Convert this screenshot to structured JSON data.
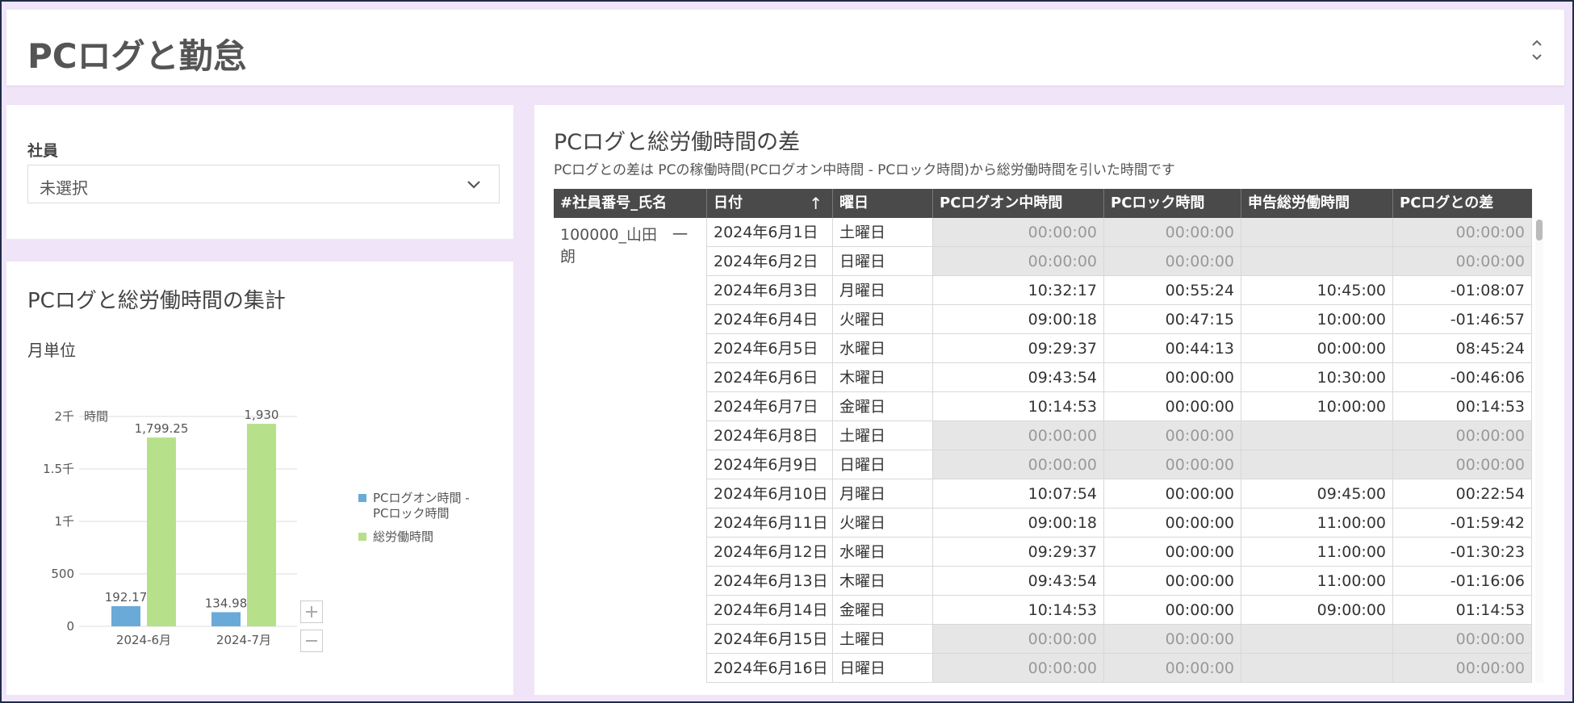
{
  "header": {
    "title": "PCログと勤怠"
  },
  "filter": {
    "label": "社員",
    "value": "未選択"
  },
  "summary_chart": {
    "title": "PCログと総労働時間の集計",
    "subtitle": "月単位",
    "colors": {
      "pc": "#6aaad8",
      "total": "#b6e08a"
    },
    "chart_data": {
      "type": "bar",
      "categories": [
        "2024-6月",
        "2024-7月"
      ],
      "series": [
        {
          "name": "PCログオン時間 - PCロック時間",
          "values": [
            192.17,
            134.98
          ]
        },
        {
          "name": "総労働時間",
          "values": [
            1799.25,
            1930
          ]
        }
      ],
      "value_labels": [
        [
          "192.17",
          "1,799.25"
        ],
        [
          "134.98",
          "1,930"
        ]
      ],
      "ylim": [
        0,
        2000
      ],
      "yticks": [
        0,
        500,
        1000,
        1500,
        2000
      ],
      "ytick_labels": [
        "0",
        "500",
        "1千",
        "1.5千",
        "2千"
      ],
      "ylabel": "時間",
      "grid": true,
      "legend": "right"
    },
    "zoom": {
      "in": "+",
      "out": "−"
    }
  },
  "table": {
    "title": "PCログと総労働時間の差",
    "note": "PCログとの差は PCの稼働時間(PCログオン中時間 - PCロック時間)から総労働時間を引いた時間です",
    "columns": [
      "#社員番号_氏名",
      "日付",
      "曜日",
      "PCログオン中時間",
      "PCロック時間",
      "申告総労働時間",
      "PCログとの差"
    ],
    "sort_indicator": "↑",
    "employee": "100000_山田　一朗",
    "rows": [
      {
        "date": "2024年6月1日",
        "day": "土曜日",
        "logon": "00:00:00",
        "lock": "00:00:00",
        "declared": "",
        "diff": "00:00:00",
        "weekend": true
      },
      {
        "date": "2024年6月2日",
        "day": "日曜日",
        "logon": "00:00:00",
        "lock": "00:00:00",
        "declared": "",
        "diff": "00:00:00",
        "weekend": true
      },
      {
        "date": "2024年6月3日",
        "day": "月曜日",
        "logon": "10:32:17",
        "lock": "00:55:24",
        "declared": "10:45:00",
        "diff": "-01:08:07",
        "weekend": false
      },
      {
        "date": "2024年6月4日",
        "day": "火曜日",
        "logon": "09:00:18",
        "lock": "00:47:15",
        "declared": "10:00:00",
        "diff": "-01:46:57",
        "weekend": false
      },
      {
        "date": "2024年6月5日",
        "day": "水曜日",
        "logon": "09:29:37",
        "lock": "00:44:13",
        "declared": "00:00:00",
        "diff": "08:45:24",
        "weekend": false
      },
      {
        "date": "2024年6月6日",
        "day": "木曜日",
        "logon": "09:43:54",
        "lock": "00:00:00",
        "declared": "10:30:00",
        "diff": "-00:46:06",
        "weekend": false
      },
      {
        "date": "2024年6月7日",
        "day": "金曜日",
        "logon": "10:14:53",
        "lock": "00:00:00",
        "declared": "10:00:00",
        "diff": "00:14:53",
        "weekend": false
      },
      {
        "date": "2024年6月8日",
        "day": "土曜日",
        "logon": "00:00:00",
        "lock": "00:00:00",
        "declared": "",
        "diff": "00:00:00",
        "weekend": true
      },
      {
        "date": "2024年6月9日",
        "day": "日曜日",
        "logon": "00:00:00",
        "lock": "00:00:00",
        "declared": "",
        "diff": "00:00:00",
        "weekend": true
      },
      {
        "date": "2024年6月10日",
        "day": "月曜日",
        "logon": "10:07:54",
        "lock": "00:00:00",
        "declared": "09:45:00",
        "diff": "00:22:54",
        "weekend": false
      },
      {
        "date": "2024年6月11日",
        "day": "火曜日",
        "logon": "09:00:18",
        "lock": "00:00:00",
        "declared": "11:00:00",
        "diff": "-01:59:42",
        "weekend": false
      },
      {
        "date": "2024年6月12日",
        "day": "水曜日",
        "logon": "09:29:37",
        "lock": "00:00:00",
        "declared": "11:00:00",
        "diff": "-01:30:23",
        "weekend": false
      },
      {
        "date": "2024年6月13日",
        "day": "木曜日",
        "logon": "09:43:54",
        "lock": "00:00:00",
        "declared": "11:00:00",
        "diff": "-01:16:06",
        "weekend": false
      },
      {
        "date": "2024年6月14日",
        "day": "金曜日",
        "logon": "10:14:53",
        "lock": "00:00:00",
        "declared": "09:00:00",
        "diff": "01:14:53",
        "weekend": false
      },
      {
        "date": "2024年6月15日",
        "day": "土曜日",
        "logon": "00:00:00",
        "lock": "00:00:00",
        "declared": "",
        "diff": "00:00:00",
        "weekend": true
      },
      {
        "date": "2024年6月16日",
        "day": "日曜日",
        "logon": "00:00:00",
        "lock": "00:00:00",
        "declared": "",
        "diff": "00:00:00",
        "weekend": true
      }
    ]
  }
}
